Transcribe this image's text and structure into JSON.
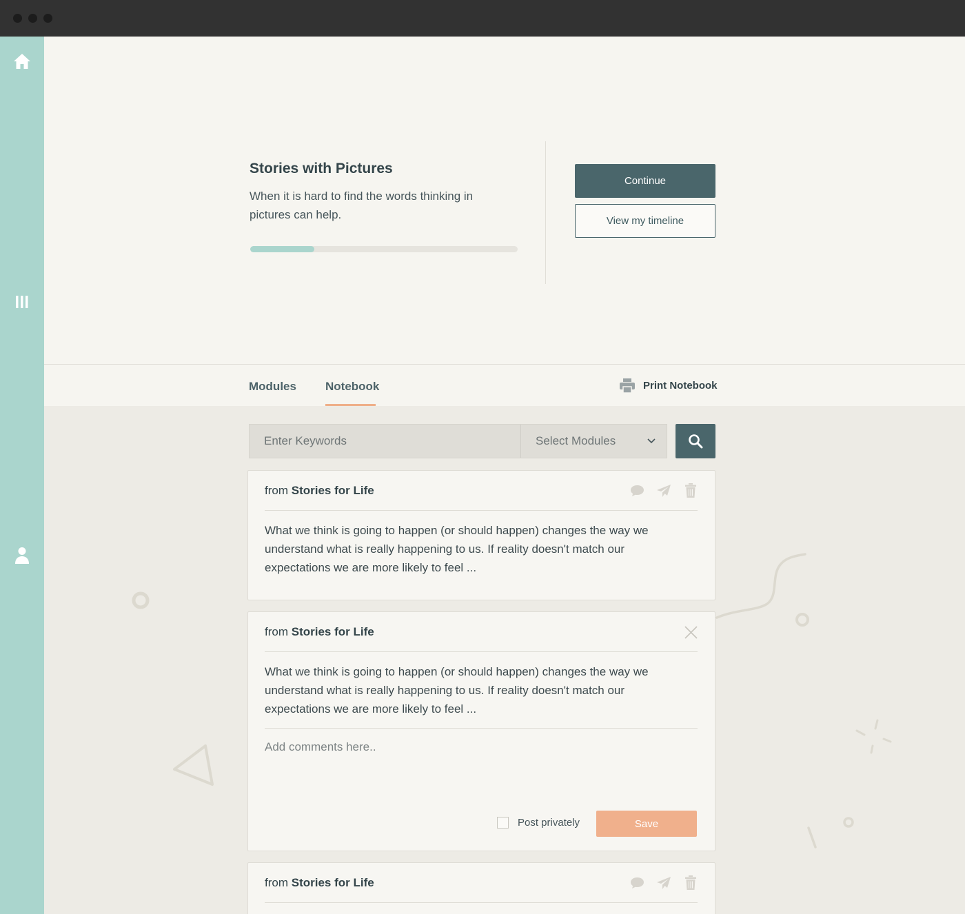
{
  "window": {
    "controls": [
      "close",
      "minimize",
      "maximize"
    ]
  },
  "sidebar": {
    "items": [
      {
        "icon": "home-icon"
      },
      {
        "icon": "modules-icon"
      },
      {
        "icon": "profile-icon"
      }
    ],
    "color": "#aad5cd"
  },
  "course": {
    "title": "Stories with Pictures",
    "description": "When it is hard to find the words thinking in pictures can help.",
    "progress": 0.24
  },
  "actions": {
    "continue_label": "Continue",
    "timeline_label": "View my timeline"
  },
  "tabs": {
    "modules_label": "Modules",
    "notebook_label": "Notebook",
    "active": "Notebook",
    "print_label": "Print Notebook"
  },
  "search": {
    "keywords_placeholder": "Enter Keywords",
    "modules_select_label": "Select Modules"
  },
  "entries": [
    {
      "from_prefix": "from",
      "source": "Stories for Life",
      "text": "What we think is going to happen (or should happen) changes the way we understand what is really happening to us. If reality doesn't match our expectations we are more likely to feel ..."
    },
    {
      "from_prefix": "from",
      "source": "Stories for Life",
      "text": "What we think is going to happen (or should happen) changes the way we understand what is really happening to us. If reality doesn't match our expectations we are more likely to feel ...",
      "comment_placeholder": "Add comments here..",
      "private_label": "Post privately",
      "save_label": "Save"
    },
    {
      "from_prefix": "from",
      "source": "Stories for Life"
    }
  ],
  "colors": {
    "accent": "#4a666b",
    "save": "#f0b08c",
    "tab_underline": "#efaf89"
  }
}
